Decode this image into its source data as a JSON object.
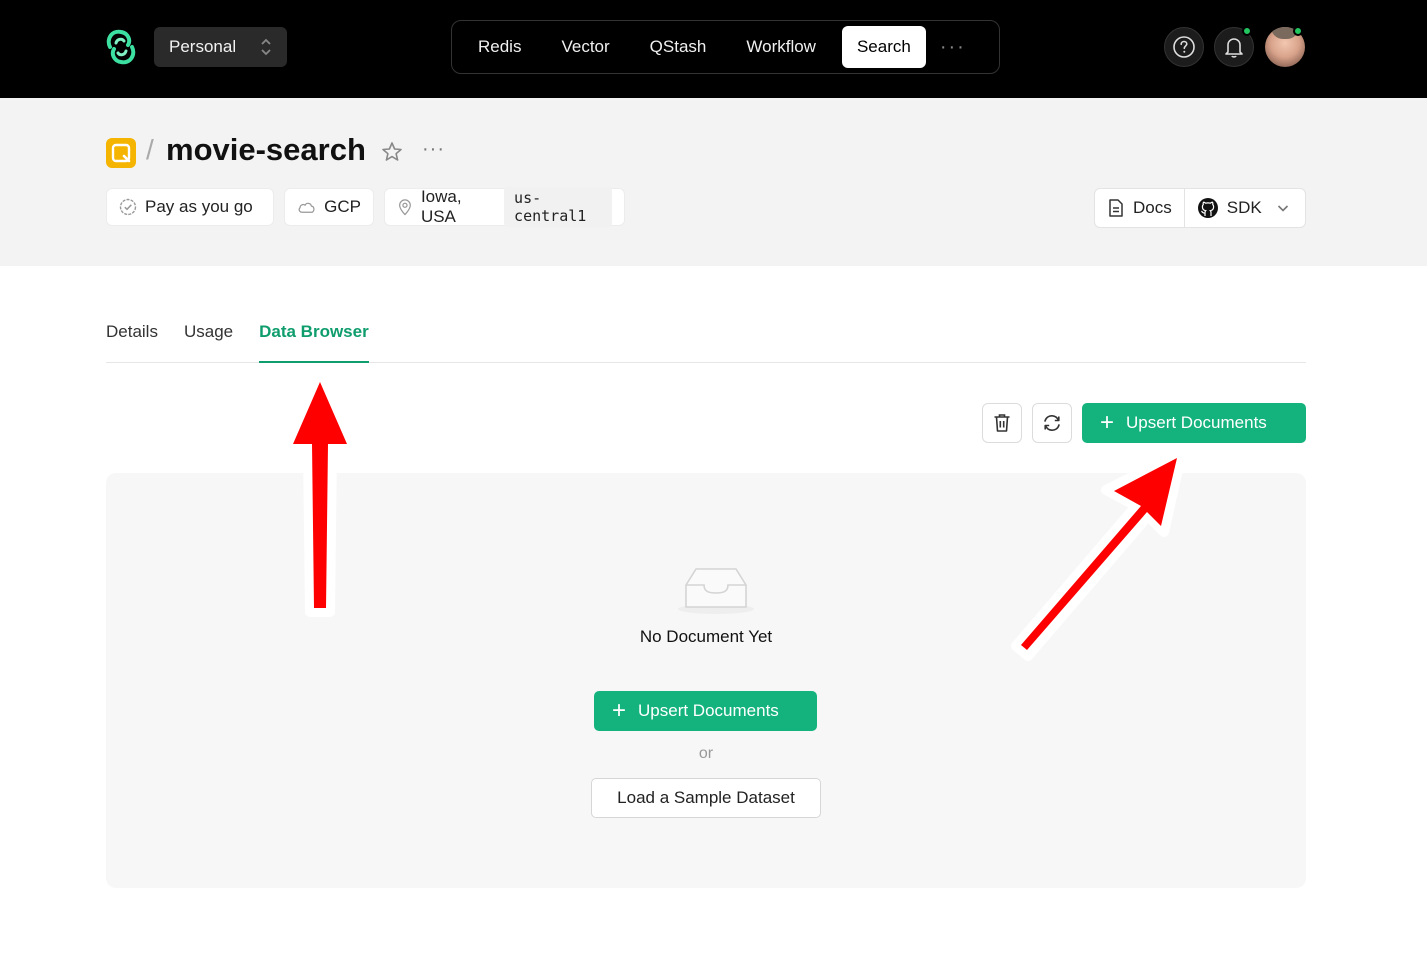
{
  "topbar": {
    "workspace_label": "Personal",
    "nav": [
      "Redis",
      "Vector",
      "QStash",
      "Workflow",
      "Search"
    ],
    "nav_active": "Search",
    "more": "···",
    "colors": {
      "background": "#000000",
      "notification_dot": "#22c55e"
    }
  },
  "database": {
    "name": "movie-search",
    "separator": "/",
    "more": "···",
    "plan": "Pay as you go",
    "provider": "GCP",
    "region": "Iowa, USA",
    "region_code": "us-central1"
  },
  "links": {
    "docs": "Docs",
    "sdk": "SDK"
  },
  "tabs": {
    "details": "Details",
    "usage": "Usage",
    "data_browser": "Data Browser",
    "active": "Data Browser"
  },
  "actions": {
    "upsert": "Upsert Documents",
    "delete_icon": "trash-icon",
    "refresh_icon": "refresh-icon"
  },
  "empty_state": {
    "message": "No Document Yet",
    "upsert": "Upsert Documents",
    "or": "or",
    "sample": "Load a Sample Dataset"
  },
  "colors": {
    "accent": "#14b37d",
    "tab_active": "#0f9d6e",
    "db_icon": "#f5b400",
    "annotation_arrow": "#ff0000"
  }
}
